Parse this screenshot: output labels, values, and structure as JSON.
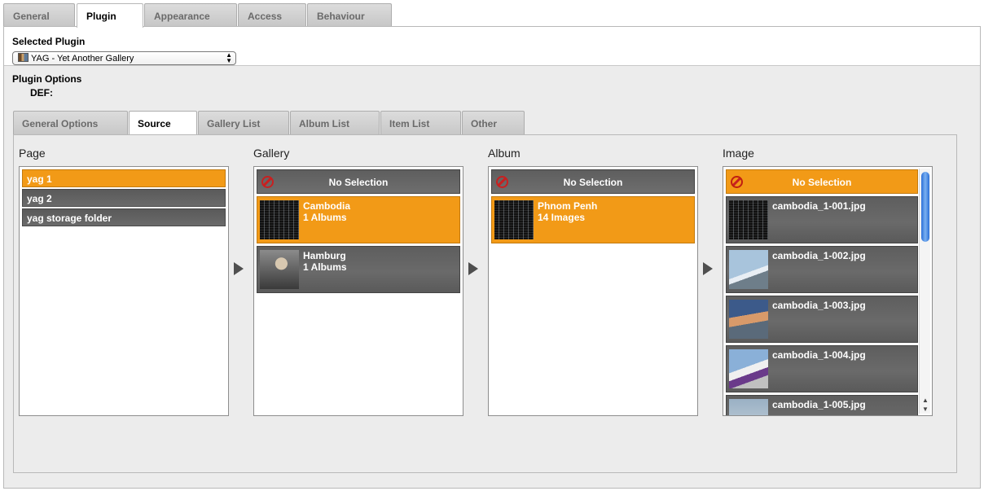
{
  "top_tabs": [
    "General",
    "Plugin",
    "Appearance",
    "Access",
    "Behaviour"
  ],
  "selected_plugin": {
    "label": "Selected Plugin",
    "value": "YAG - Yet Another Gallery"
  },
  "plugin_options": {
    "label": "Plugin Options",
    "sublabel": "DEF:"
  },
  "sub_tabs": [
    "General Options",
    "Source",
    "Gallery List",
    "Album List",
    "Item List",
    "Other"
  ],
  "columns": {
    "page": {
      "title": "Page",
      "items": [
        "yag 1",
        "yag 2",
        "yag storage folder"
      ]
    },
    "gallery": {
      "title": "Gallery",
      "no_selection": "No Selection",
      "items": [
        {
          "name": "Cambodia",
          "sub": "1 Albums"
        },
        {
          "name": "Hamburg",
          "sub": "1 Albums"
        }
      ]
    },
    "album": {
      "title": "Album",
      "no_selection": "No Selection",
      "items": [
        {
          "name": "Phnom Penh",
          "sub": "14 Images"
        }
      ]
    },
    "image": {
      "title": "Image",
      "no_selection": "No Selection",
      "items": [
        "cambodia_1-001.jpg",
        "cambodia_1-002.jpg",
        "cambodia_1-003.jpg",
        "cambodia_1-004.jpg",
        "cambodia_1-005.jpg"
      ]
    }
  },
  "colors": {
    "selected": "#f29a17",
    "item_bg": "#636363",
    "tab_active": "#ffffff",
    "panel_bg": "#ececec"
  }
}
